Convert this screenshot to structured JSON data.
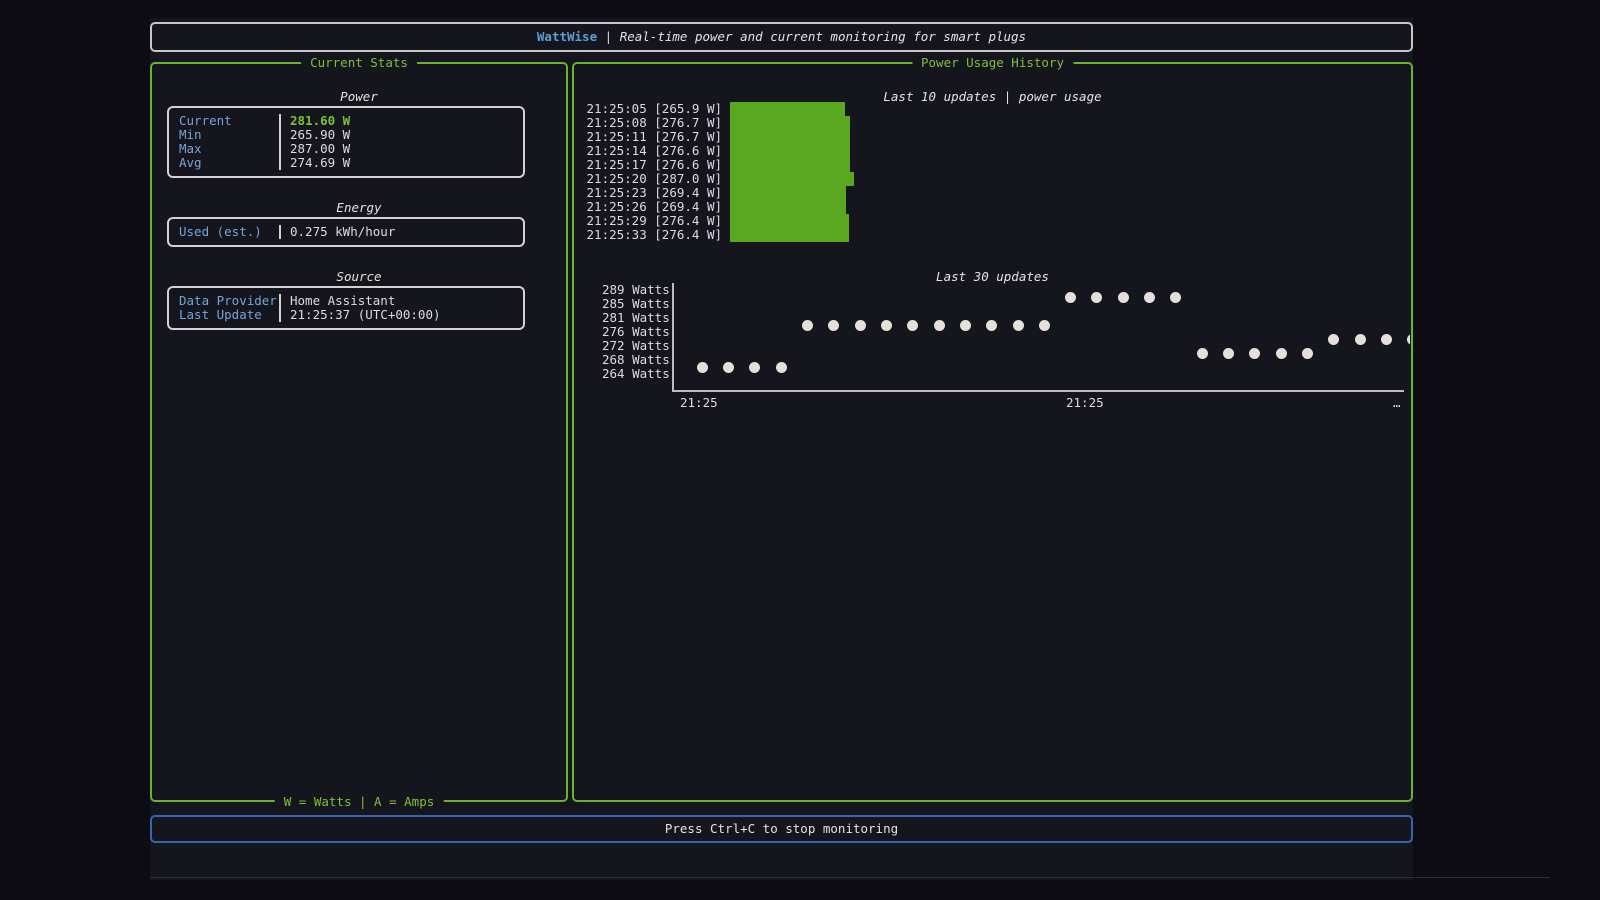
{
  "header": {
    "app_name": "WattWise",
    "separator": " | ",
    "subtitle": "Real-time power and current monitoring for smart plugs"
  },
  "stats_panel": {
    "title": "Current Stats",
    "footer": "W = Watts | A = Amps",
    "sections": [
      {
        "title": "Power",
        "rows": [
          {
            "label": "Current",
            "value": "281.60 W",
            "highlight": true
          },
          {
            "label": "Min",
            "value": "265.90 W",
            "highlight": false
          },
          {
            "label": "Max",
            "value": "287.00 W",
            "highlight": false
          },
          {
            "label": "Avg",
            "value": "274.69 W",
            "highlight": false
          }
        ]
      },
      {
        "title": "Energy",
        "rows": [
          {
            "label": "Used (est.)",
            "value": "0.275 kWh/hour",
            "highlight": false
          }
        ]
      },
      {
        "title": "Source",
        "rows": [
          {
            "label": "Data Provider",
            "value": "Home Assistant",
            "highlight": false
          },
          {
            "label": "Last Update",
            "value": "21:25:37  (UTC+00:00)",
            "highlight": false
          }
        ]
      }
    ]
  },
  "history_panel": {
    "title": "Power Usage History"
  },
  "chart_data": [
    {
      "type": "bar",
      "orientation": "horizontal",
      "title": "Last 10 updates | power usage",
      "categories": [
        "21:25:05",
        "21:25:08",
        "21:25:11",
        "21:25:14",
        "21:25:17",
        "21:25:20",
        "21:25:23",
        "21:25:26",
        "21:25:29",
        "21:25:33"
      ],
      "values": [
        265.9,
        276.7,
        276.7,
        276.6,
        276.6,
        287.0,
        269.4,
        269.4,
        276.4,
        276.4
      ],
      "unit": "W",
      "label_format": "{time} [{value} W]",
      "xlim": [
        0,
        287
      ],
      "bar_color": "#5aa720",
      "legend": "none",
      "grid": false
    },
    {
      "type": "scatter",
      "title": "Last 30 updates",
      "ytick_labels": [
        "289 Watts",
        "285 Watts",
        "281 Watts",
        "276 Watts",
        "272 Watts",
        "268 Watts",
        "264 Watts"
      ],
      "ytick_values": [
        289,
        285,
        281,
        276,
        272,
        268,
        264
      ],
      "ylim": [
        264,
        289
      ],
      "xtick_labels": [
        "21:25",
        "21:25",
        "…"
      ],
      "points_watts": [
        264,
        264,
        264,
        264,
        276,
        276,
        276,
        276,
        276,
        276,
        276,
        276,
        276,
        276,
        285,
        285,
        285,
        285,
        285,
        268,
        268,
        268,
        268,
        268,
        272,
        272,
        272,
        272
      ],
      "dot_color": "#e5e1d8",
      "legend": "none",
      "grid": false
    }
  ],
  "footer_bar": {
    "message": "Press Ctrl+C to stop monitoring"
  },
  "colors": {
    "background": "#0c0c12",
    "terminal_background": "#15151e",
    "accent_green": "#7cc32f",
    "panel_border_green": "#69b42a",
    "bar_green": "#5aa720",
    "title_blue": "#5b9fd3",
    "label_blue": "#74a5d8",
    "footer_border_blue": "#3465b0",
    "text": "#dcdcdb",
    "box_border_gray": "#c6c6c4",
    "dot": "#e5e1d8"
  }
}
